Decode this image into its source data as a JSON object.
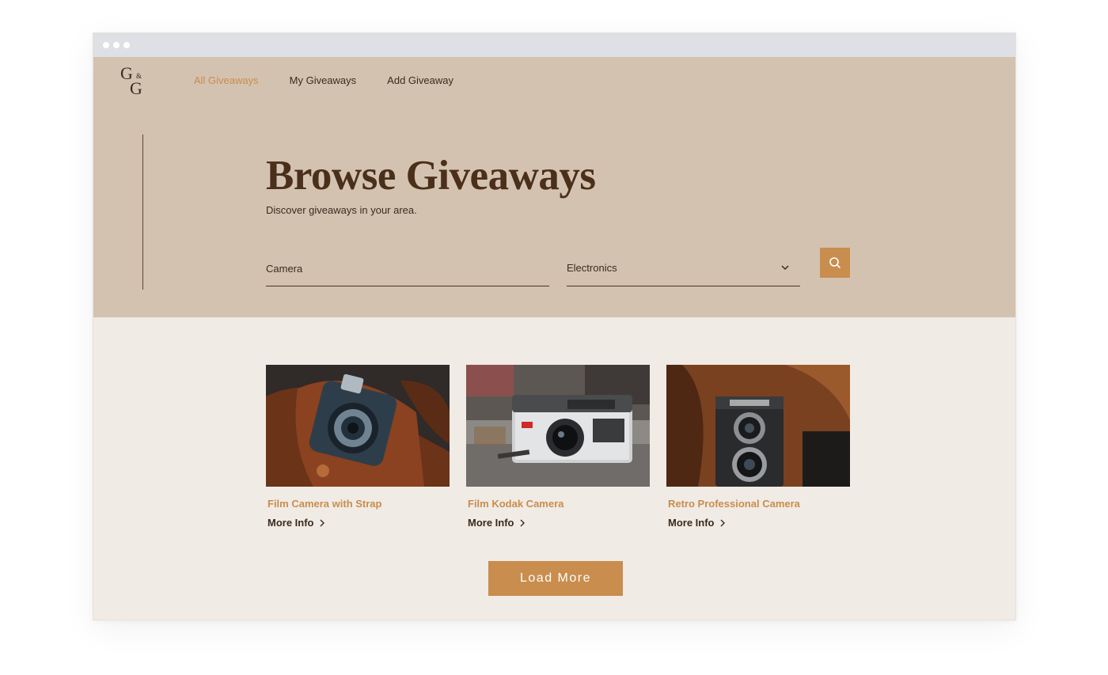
{
  "brand": {
    "logo_top": "G",
    "logo_amp": "&",
    "logo_bottom": "G"
  },
  "nav": {
    "items": [
      {
        "label": "All Giveaways",
        "active": true
      },
      {
        "label": "My Giveaways",
        "active": false
      },
      {
        "label": "Add Giveaway",
        "active": false
      }
    ]
  },
  "hero": {
    "title": "Browse Giveaways",
    "subtitle": "Discover giveaways in your area."
  },
  "search": {
    "query_value": "Camera",
    "category_selected": "Electronics",
    "search_icon": "search-icon"
  },
  "listings": [
    {
      "title": "Film Camera with Strap",
      "link": "More Info",
      "image": "leather-strap-film-camera"
    },
    {
      "title": "Film Kodak Camera",
      "link": "More Info",
      "image": "kodak-instamatic-camera"
    },
    {
      "title": "Retro Professional Camera",
      "link": "More Info",
      "image": "twin-lens-reflex-camera"
    }
  ],
  "load_more": {
    "label": "Load More"
  },
  "colors": {
    "accent": "#c98d4e",
    "hero_bg": "#d4c2b1",
    "page_bg": "#f0ebe4",
    "text_dark": "#3b2a1d",
    "title_brown": "#4a2f1a"
  }
}
